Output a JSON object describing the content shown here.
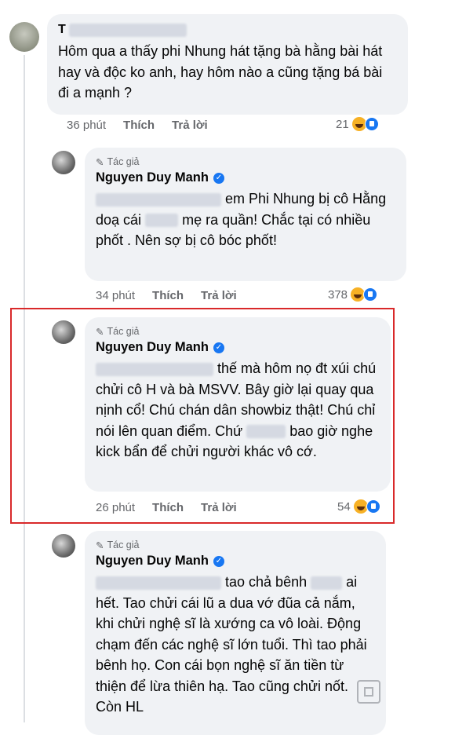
{
  "comments": [
    {
      "author_blurred": "T",
      "text": "Hôm qua a thấy phi Nhung hát tặng bà hằng bài hát hay và độc ko anh, hay hôm nào a cũng tặng bá bài đi a mạnh ?",
      "time": "36 phút",
      "like": "Thích",
      "reply": "Trả lời",
      "reactions": "21"
    },
    {
      "author_tag": "Tác giả",
      "author": "Nguyen Duy Manh",
      "text_parts": [
        "em Phi Nhung bị cô Hằng doạ cái",
        "mẹ ra quần! Chắc tại có nhiều phốt . Nên sợ bị cô bóc phốt!"
      ],
      "time": "34 phút",
      "like": "Thích",
      "reply": "Trả lời",
      "reactions": "378"
    },
    {
      "author_tag": "Tác giả",
      "author": "Nguyen Duy Manh",
      "text_parts": [
        "thế mà hôm nọ đt xúi chú chửi cô H và bà MSVV. Bây giờ lại quay qua nịnh cổ! Chú chán dân showbiz thật! Chú chỉ nói lên quan điểm. Chứ",
        "bao giờ nghe kick bẩn để chửi người khác vô cớ."
      ],
      "time": "26 phút",
      "like": "Thích",
      "reply": "Trả lời",
      "reactions": "54"
    },
    {
      "author_tag": "Tác giả",
      "author": "Nguyen Duy Manh",
      "text_parts": [
        "tao chả bênh",
        "ai hết. Tao chửi cái lũ a dua vớ đũa cả nắm, khi chửi nghệ sĩ là xướng ca vô loài. Động chạm đến các nghệ sĩ lớn tuổi. Thì tao phải bênh họ. Con cái bọn nghệ sĩ ăn tiền từ thiện để lừa thiên hạ. Tao cũng chửi nốt. Còn HL"
      ]
    }
  ],
  "colors": {
    "highlight": "#d9292a",
    "verified": "#1877f2",
    "bubble": "#f0f2f5"
  }
}
